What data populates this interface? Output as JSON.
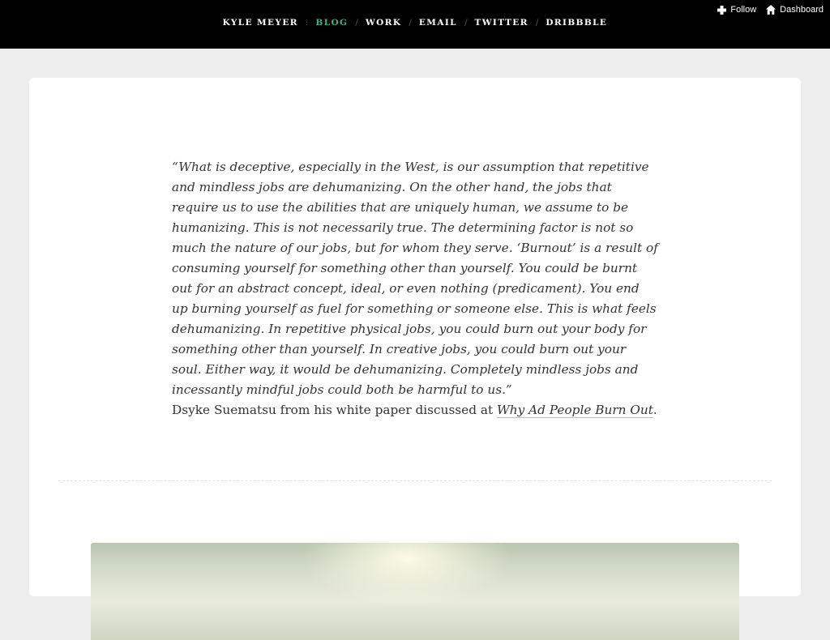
{
  "nav": {
    "items": [
      {
        "label": "Kyle Meyer"
      },
      {
        "label": "Blog"
      },
      {
        "label": "Work"
      },
      {
        "label": "Email"
      },
      {
        "label": "Twitter"
      },
      {
        "label": "Dribbble"
      }
    ],
    "separators": [
      ":",
      "/",
      "/",
      "/",
      "/"
    ]
  },
  "controls": {
    "follow_label": "Follow",
    "dashboard_label": "Dashboard"
  },
  "post": {
    "quote": "“What is deceptive, especially in the West, is our assumption that repetitive and mindless jobs are dehumanizing. On the other hand, the jobs that require us to use the abilities that are uniquely human, we assume to be humanizing. This is not necessarily true. The determining factor is not so much the nature of our jobs, but for whom they serve. ‘Burnout’ is a result of consuming yourself for something other than yourself. You could be burnt out for an abstract concept, ideal, or even nothing (predicament). You end up burning yourself as fuel for something or someone else. This is what feels dehumanizing. In repetitive physical jobs, you could burn out your body for something other than yourself. In creative jobs, you could burn out your soul. Either way, it would be dehumanizing. Completely mindless jobs and incessantly mindful jobs could both be harmful to us.”",
    "source_prefix": "Dsyke Suematsu from his white paper discussed at ",
    "source_link": "Why Ad People Burn Out",
    "source_suffix": "."
  },
  "colors": {
    "active_nav": "#3fb37f",
    "topbar": "#000000",
    "page_bg": "#ededed"
  }
}
